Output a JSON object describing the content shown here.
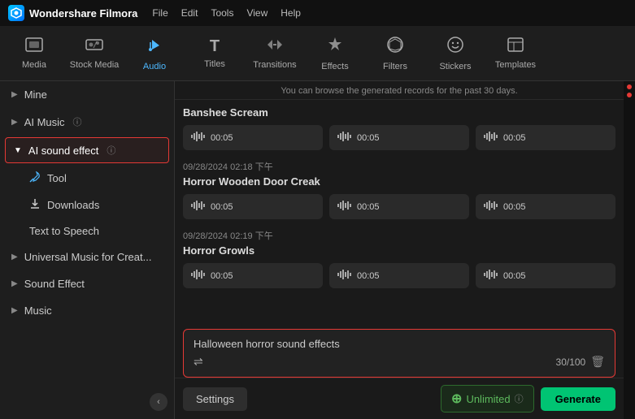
{
  "brand": {
    "name": "Wondershare Filmora",
    "icon_label": "W"
  },
  "menu": {
    "items": [
      "File",
      "Edit",
      "Tools",
      "View",
      "Help"
    ]
  },
  "toolbar": {
    "items": [
      {
        "id": "media",
        "label": "Media",
        "icon": "🖼"
      },
      {
        "id": "stock-media",
        "label": "Stock Media",
        "icon": "📷"
      },
      {
        "id": "audio",
        "label": "Audio",
        "icon": "🎵",
        "active": true
      },
      {
        "id": "titles",
        "label": "Titles",
        "icon": "T"
      },
      {
        "id": "transitions",
        "label": "Transitions",
        "icon": "↔"
      },
      {
        "id": "effects",
        "label": "Effects",
        "icon": "✦"
      },
      {
        "id": "filters",
        "label": "Filters",
        "icon": "⬡"
      },
      {
        "id": "stickers",
        "label": "Stickers",
        "icon": "✿"
      },
      {
        "id": "templates",
        "label": "Templates",
        "icon": "⬜"
      }
    ]
  },
  "sidebar": {
    "items": [
      {
        "id": "mine",
        "label": "Mine",
        "type": "collapsible",
        "expanded": false
      },
      {
        "id": "ai-music",
        "label": "AI Music",
        "type": "collapsible",
        "expanded": false,
        "has_info": true
      },
      {
        "id": "ai-sound-effect",
        "label": "AI sound effect",
        "type": "collapsible",
        "expanded": true,
        "active": true,
        "has_info": true
      },
      {
        "id": "tool",
        "label": "Tool",
        "type": "sub",
        "icon": "🔧"
      },
      {
        "id": "downloads",
        "label": "Downloads",
        "type": "sub",
        "icon": "⬇"
      },
      {
        "id": "text-to-speech",
        "label": "Text to Speech",
        "type": "sub-plain"
      },
      {
        "id": "universal-music",
        "label": "Universal Music for Creat...",
        "type": "collapsible",
        "expanded": false
      },
      {
        "id": "sound-effect",
        "label": "Sound Effect",
        "type": "collapsible",
        "expanded": false
      },
      {
        "id": "music",
        "label": "Music",
        "type": "collapsible",
        "expanded": false
      }
    ],
    "collapse_icon": "‹"
  },
  "content": {
    "notice": "You can browse the generated records for the past 30 days.",
    "sections": [
      {
        "id": "banshee",
        "date": "",
        "title": "Banshee Scream",
        "tracks": [
          {
            "duration": "00:05"
          },
          {
            "duration": "00:05"
          },
          {
            "duration": "00:05"
          }
        ]
      },
      {
        "id": "door-creak",
        "date": "09/28/2024 02:18 下午",
        "title": "Horror Wooden Door Creak",
        "tracks": [
          {
            "duration": "00:05"
          },
          {
            "duration": "00:05"
          },
          {
            "duration": "00:05"
          }
        ]
      },
      {
        "id": "growls",
        "date": "09/28/2024 02:19 下午",
        "title": "Horror Growls",
        "tracks": [
          {
            "duration": "00:05"
          },
          {
            "duration": "00:05"
          },
          {
            "duration": "00:05"
          }
        ]
      }
    ]
  },
  "prompt": {
    "text": "Halloween horror sound effects",
    "count": "30/100",
    "shuffle_icon": "⇌",
    "trash_icon": "🗑"
  },
  "bottom_bar": {
    "settings_label": "Settings",
    "unlimited_label": "Unlimited",
    "generate_label": "Generate",
    "info_icon": "ⓘ"
  }
}
